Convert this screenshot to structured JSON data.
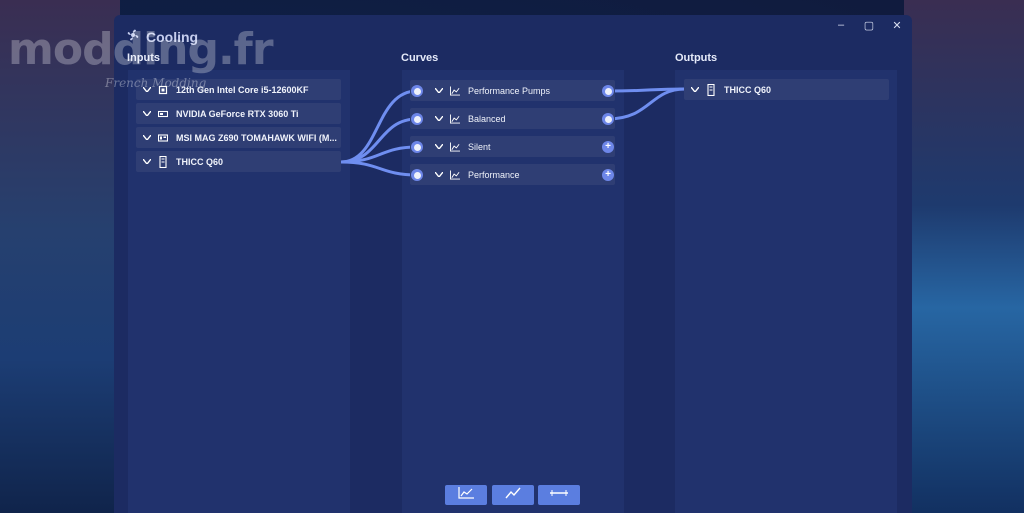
{
  "window": {
    "title": "Cooling",
    "controls": [
      "–",
      "▢",
      "✕"
    ]
  },
  "watermark": {
    "logo": "modding.fr",
    "tagline": "French Modding"
  },
  "columns": {
    "inputs": "Inputs",
    "curves": "Curves",
    "outputs": "Outputs"
  },
  "inputs": [
    {
      "label": "12th Gen Intel Core i5-12600KF",
      "icon": "cpu-icon"
    },
    {
      "label": "NVIDIA GeForce RTX 3060 Ti",
      "icon": "gpu-icon"
    },
    {
      "label": "MSI MAG Z690 TOMAHAWK WIFI (M...",
      "icon": "motherboard-icon"
    },
    {
      "label": "THICC Q60",
      "icon": "aio-cooler-icon"
    }
  ],
  "curves": [
    {
      "label": "Performance Pumps",
      "output_port": "connected"
    },
    {
      "label": "Balanced",
      "output_port": "connected"
    },
    {
      "label": "Silent",
      "output_port": "add"
    },
    {
      "label": "Performance",
      "output_port": "add"
    }
  ],
  "outputs": [
    {
      "label": "THICC Q60",
      "icon": "aio-cooler-icon"
    }
  ],
  "toolbar": [
    {
      "name": "graph-curve-button",
      "icon": "graph-curve-icon"
    },
    {
      "name": "linear-curve-button",
      "icon": "linear-curve-icon"
    },
    {
      "name": "fixed-curve-button",
      "icon": "flat-line-icon"
    }
  ],
  "colors": {
    "wire": "#6f8ef0",
    "accent": "#5b7ee0",
    "panel": "#21326d",
    "node": "#2f3e74"
  }
}
